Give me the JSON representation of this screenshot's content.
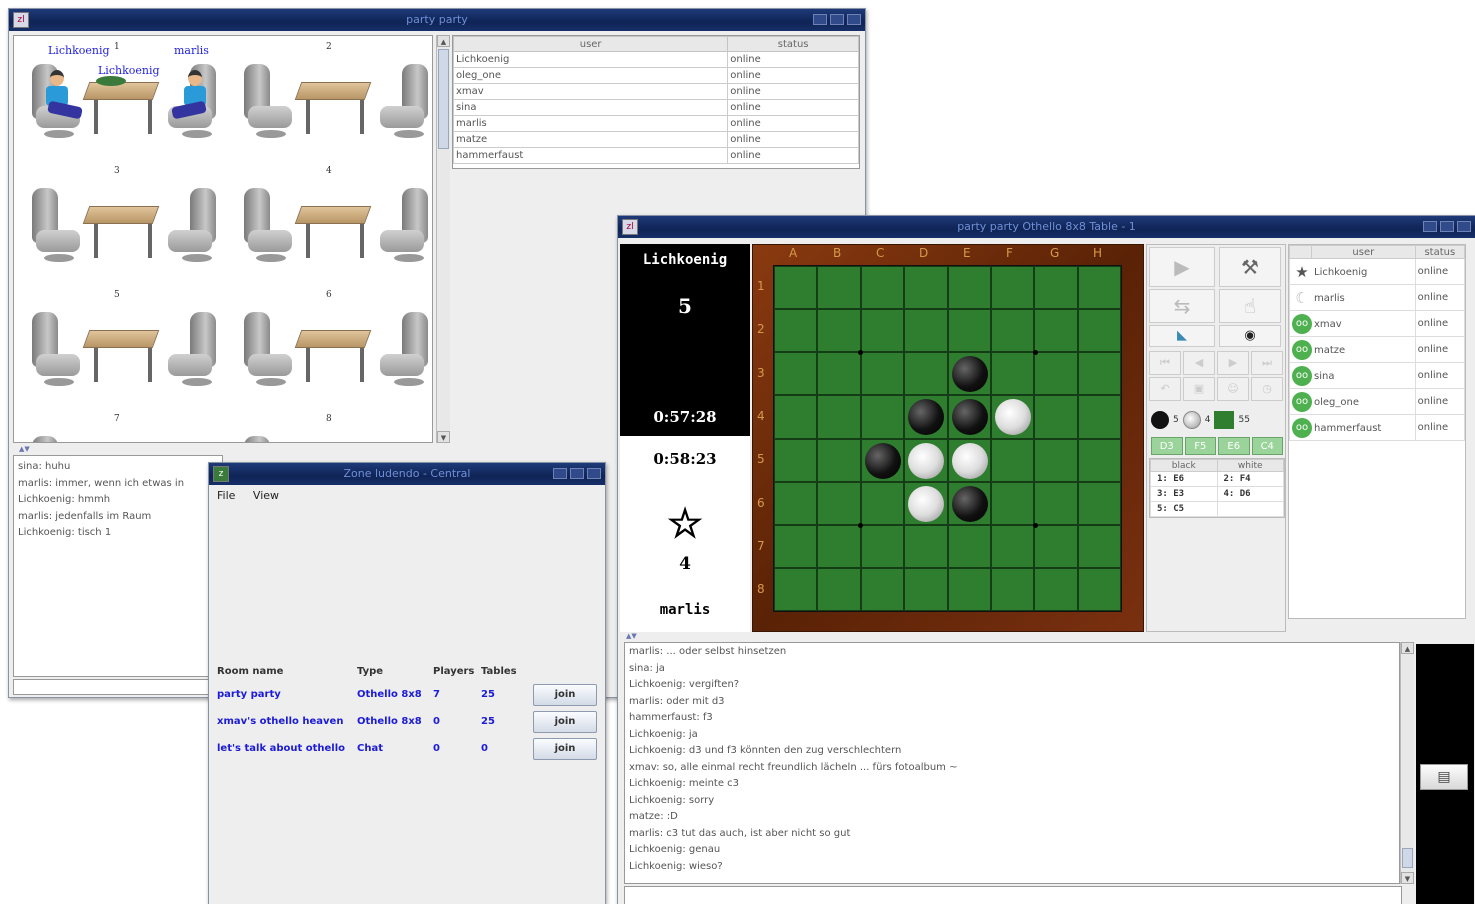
{
  "lobby": {
    "title": "party party",
    "table_numbers": [
      "1",
      "2",
      "3",
      "4",
      "5",
      "6",
      "7",
      "8"
    ],
    "player_names": [
      "Lichkoenig",
      "marlis",
      "Lichkoenig"
    ],
    "userlist": {
      "headers": [
        "user",
        "status"
      ],
      "rows": [
        [
          "Lichkoenig",
          "online"
        ],
        [
          "oleg_one",
          "online"
        ],
        [
          "xmav",
          "online"
        ],
        [
          "sina",
          "online"
        ],
        [
          "marlis",
          "online"
        ],
        [
          "matze",
          "online"
        ],
        [
          "hammerfaust",
          "online"
        ]
      ]
    },
    "chat": [
      "sina: huhu",
      "marlis: immer, wenn ich etwas in",
      "Lichkoenig: hmmh",
      "marlis: jedenfalls im Raum",
      "Lichkoenig: tisch 1"
    ]
  },
  "zone": {
    "title": "Zone ludendo - Central",
    "menu": [
      "File",
      "View"
    ],
    "headers": [
      "Room name",
      "Type",
      "Players",
      "Tables"
    ],
    "rooms": [
      {
        "name": "party party",
        "type": "Othello 8x8",
        "players": "7",
        "tables": "25",
        "action": "join"
      },
      {
        "name": "xmav's othello heaven",
        "type": "Othello 8x8",
        "players": "0",
        "tables": "25",
        "action": "join"
      },
      {
        "name": "let's talk about othello",
        "type": "Chat",
        "players": "0",
        "tables": "0",
        "action": "join"
      }
    ]
  },
  "game": {
    "title": "party party Othello 8x8 Table - 1",
    "top_player": {
      "name": "Lichkoenig",
      "score": "5",
      "time": "0:57:28"
    },
    "bottom_player": {
      "name": "marlis",
      "score": "4",
      "time": "0:58:23"
    },
    "columns": [
      "A",
      "B",
      "C",
      "D",
      "E",
      "F",
      "G",
      "H"
    ],
    "rows": [
      "1",
      "2",
      "3",
      "4",
      "5",
      "6",
      "7",
      "8"
    ],
    "discs": [
      {
        "cell": "E3",
        "color": "black"
      },
      {
        "cell": "D4",
        "color": "black"
      },
      {
        "cell": "E4",
        "color": "black"
      },
      {
        "cell": "F4",
        "color": "white"
      },
      {
        "cell": "C5",
        "color": "black"
      },
      {
        "cell": "D5",
        "color": "white"
      },
      {
        "cell": "E5",
        "color": "white"
      },
      {
        "cell": "D6",
        "color": "white"
      },
      {
        "cell": "E6",
        "color": "black"
      }
    ],
    "counts": {
      "black": "5",
      "white": "4",
      "empty": "55"
    },
    "hint_moves": [
      "D3",
      "F5",
      "E6",
      "C4"
    ],
    "move_headers": [
      "black",
      "white"
    ],
    "moves": [
      [
        "1: E6",
        "2: F4"
      ],
      [
        "3: E3",
        "4: D6"
      ],
      [
        "5: C5",
        ""
      ]
    ],
    "userlist": {
      "headers": [
        "",
        "user",
        "status"
      ],
      "rows": [
        {
          "icon": "star-icon",
          "glyph": "★",
          "name": "Lichkoenig",
          "status": "online"
        },
        {
          "icon": "moon-icon",
          "glyph": "☾",
          "name": "marlis",
          "status": "online"
        },
        {
          "icon": "spectator-icon",
          "glyph": "oo",
          "name": "xmav",
          "status": "online"
        },
        {
          "icon": "spectator-icon",
          "glyph": "oo",
          "name": "matze",
          "status": "online"
        },
        {
          "icon": "spectator-icon",
          "glyph": "oo",
          "name": "sina",
          "status": "online"
        },
        {
          "icon": "spectator-icon",
          "glyph": "oo",
          "name": "oleg_one",
          "status": "online"
        },
        {
          "icon": "spectator-icon",
          "glyph": "oo",
          "name": "hammerfaust",
          "status": "online"
        }
      ]
    },
    "chat": [
      "marlis: ... oder selbst hinsetzen",
      "sina: ja",
      "Lichkoenig: vergiften?",
      "marlis: oder mit d3",
      "hammerfaust: f3",
      "Lichkoenig: ja",
      "Lichkoenig: d3 und f3 könnten den zug verschlechtern",
      "xmav: so, alle einmal recht freundlich lächeln ... fürs fotoalbum ~",
      "Lichkoenig: meinte c3",
      "Lichkoenig: sorry",
      "matze: :D",
      "marlis: c3 tut das auch, ist aber nicht so gut",
      "Lichkoenig: genau",
      "Lichkoenig: wieso?"
    ]
  }
}
